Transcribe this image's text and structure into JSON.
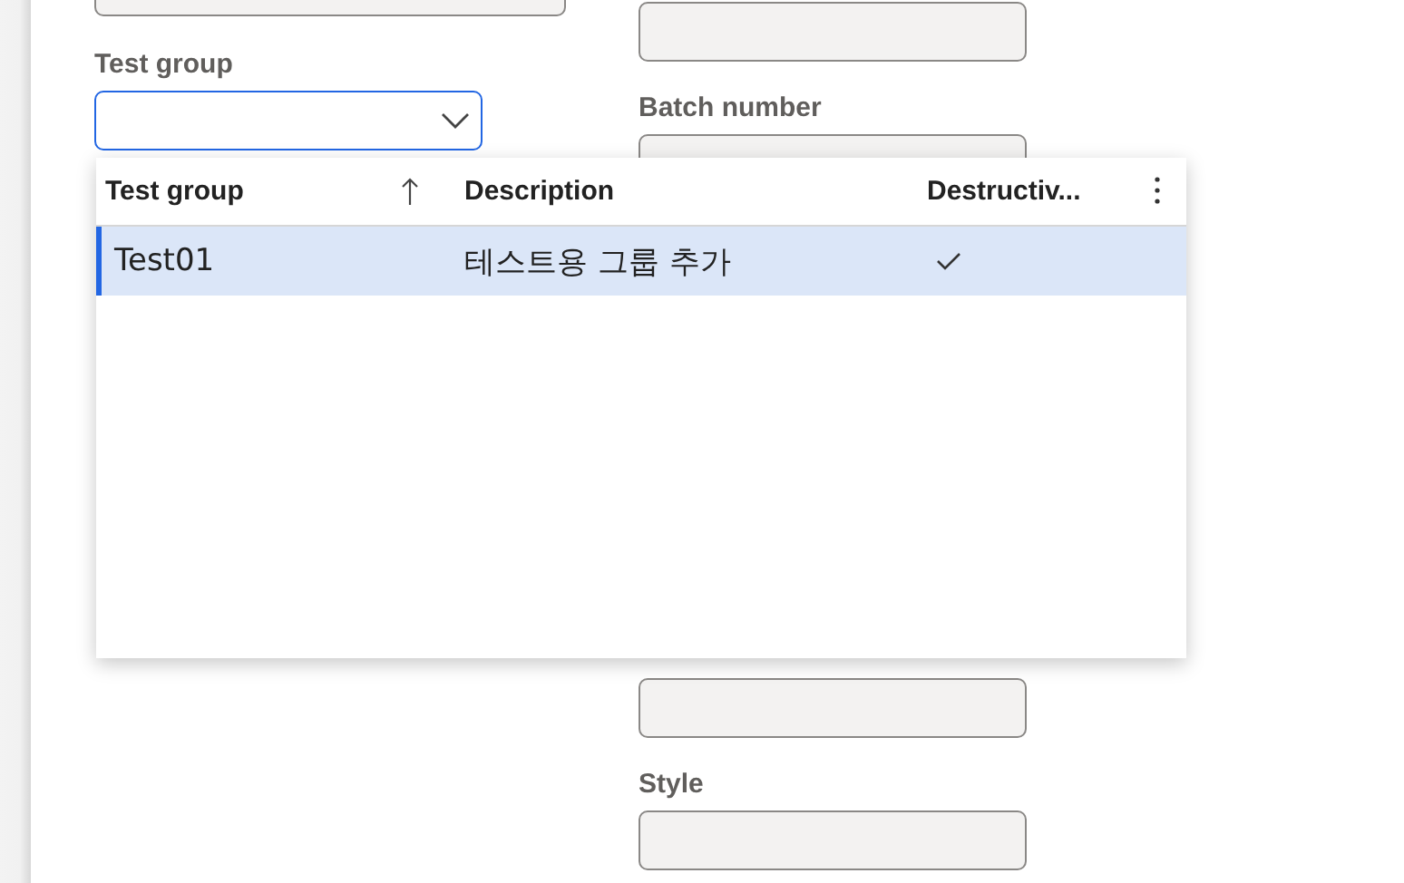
{
  "form": {
    "left_fields": [
      {
        "label": "Test group",
        "kind": "dropdown",
        "focused": true
      }
    ],
    "right_fields": [
      {
        "kind": "labeled",
        "label": "Batch number"
      },
      {
        "kind": "unlabeled"
      },
      {
        "kind": "labeled",
        "label": "Style"
      }
    ]
  },
  "lookup": {
    "columns": [
      {
        "label": "Test group",
        "sorted": true
      },
      {
        "label": "Description",
        "sorted": false
      },
      {
        "label": "Destructiv...",
        "sorted": false
      }
    ],
    "rows": [
      {
        "test_group": "Test01",
        "description": "테스트용 그룹 추가",
        "destructive": true,
        "selected": true
      }
    ]
  }
}
